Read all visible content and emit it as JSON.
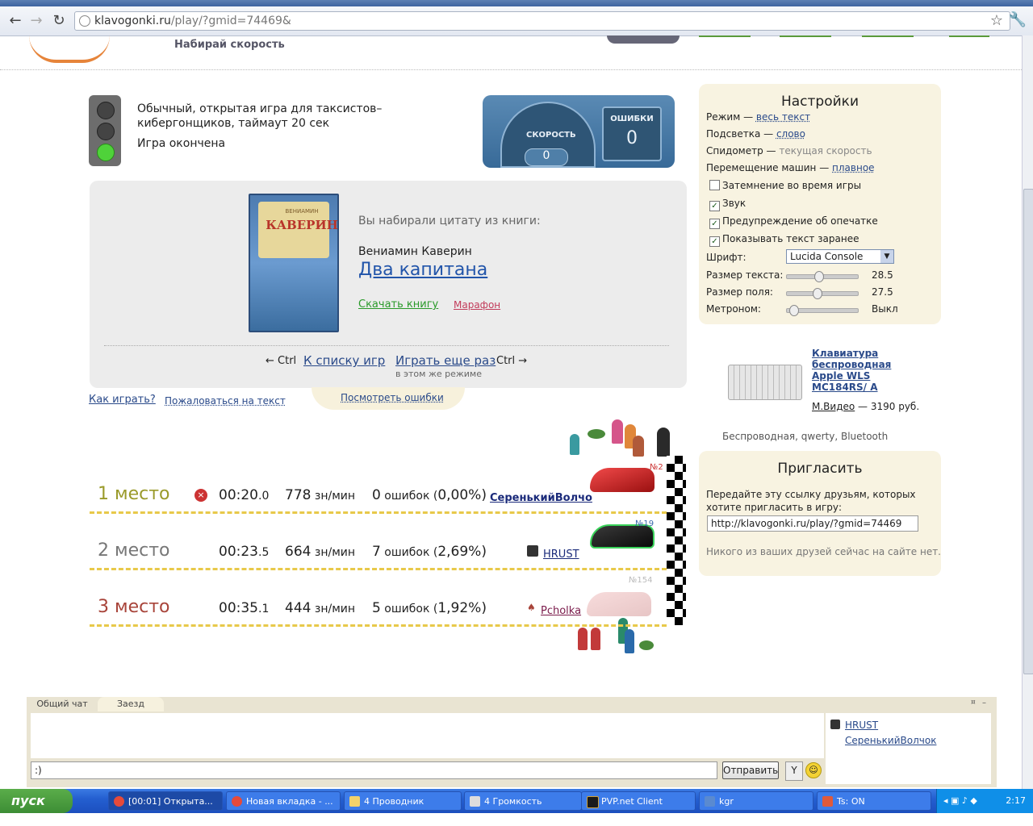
{
  "browser": {
    "url_host": "klavogonki.ru",
    "url_path": "/play/?gmid=74469&"
  },
  "header": {
    "slogan": "Набирай скорость"
  },
  "game": {
    "description": "Обычный, открытая игра для таксистов–кибергонщиков, таймаут 20 сек",
    "status": "Игра окончена",
    "speed_label": "СКОРОСТЬ",
    "speed_value": "0",
    "errors_label": "ОШИБКИ",
    "errors_value": "0"
  },
  "book": {
    "cover_author": "КАВЕРИН",
    "cover_small": "ВЕНИАМИН",
    "intro": "Вы набирали цитату из книги:",
    "author": "Вениамин Каверин",
    "title": "Два капитана",
    "download": "Скачать книгу",
    "marathon": "Марафон",
    "ctrl_left": "← Ctrl",
    "back_to_list": "К списку игр",
    "play_again": "Играть еще раз",
    "ctrl_right": "Ctrl →",
    "same_mode": "в этом же режиме"
  },
  "links": {
    "how_to_play": "Как играть?",
    "complain": "Пожаловаться на текст",
    "view_errors": "Посмотреть ошибки"
  },
  "results": [
    {
      "place": "1 место",
      "time_main": "00:20",
      "time_frac": ".0",
      "speed": "778",
      "speed_unit": " зн/мин",
      "errors": "0",
      "errors_text": " ошибок (",
      "percent": "0,00%",
      "close": ")",
      "player": "СеренькийВолчо",
      "badge": "№2",
      "color": "#9a9a2a"
    },
    {
      "place": "2 место",
      "time_main": "00:23",
      "time_frac": ".5",
      "speed": "664",
      "speed_unit": " зн/мин",
      "errors": "7",
      "errors_text": " ошибок (",
      "percent": "2,69%",
      "close": ")",
      "player": "HRUST",
      "badge": "№19",
      "color": "#777777"
    },
    {
      "place": "3 место",
      "time_main": "00:35",
      "time_frac": ".1",
      "speed": "444",
      "speed_unit": " зн/мин",
      "errors": "5",
      "errors_text": " ошибок (",
      "percent": "1,92%",
      "close": ")",
      "player": "Pcholka",
      "badge": "№154",
      "color": "#a8443a"
    }
  ],
  "settings": {
    "title": "Настройки",
    "mode_label": "Режим — ",
    "mode_value": "весь текст",
    "highlight_label": "Подсветка — ",
    "highlight_value": "слово",
    "speedo_label": "Спидометр — ",
    "speedo_value": "текущая скорость",
    "car_move_label": "Перемещение машин — ",
    "car_move_value": "плавное",
    "dim": "Затемнение во время игры",
    "sound": "Звук",
    "typo_warning": "Предупреждение об опечатке",
    "show_text": "Показывать текст заранее",
    "font_label": "Шрифт:",
    "font_value": "Lucida Console",
    "text_size_label": "Размер текста:",
    "text_size_value": "28.5",
    "field_size_label": "Размер поля:",
    "field_size_value": "27.5",
    "metronome_label": "Метроном:",
    "metronome_value": "Выкл"
  },
  "ad": {
    "title": "Клавиатура беспроводная Apple WLS MC184RS/ A",
    "shop": "М.Видео",
    "price": " — 3190 руб.",
    "desc": "Беспроводная, qwerty, Bluetooth"
  },
  "invite": {
    "title": "Пригласить",
    "text": "Передайте эту ссылку друзьям, которых хотите пригласить в игру:",
    "url": "http://klavogonki.ru/play/?gmid=74469",
    "friends": "Никого из ваших друзей сейчас на сайте нет."
  },
  "chat": {
    "tab_general": "Общий чат",
    "tab_race": "Заезд",
    "input": ":)",
    "send": "Отправить",
    "users": [
      "HRUST",
      "СеренькийВолчок"
    ]
  },
  "taskbar": {
    "start": "пуск",
    "tasks": [
      "[00:01] Открыта...",
      "Новая вкладка - ...",
      "4 Проводник",
      "4 Громкость",
      "PVP.net Client",
      "kgr",
      "Ts: ON"
    ],
    "clock": "2:17"
  }
}
